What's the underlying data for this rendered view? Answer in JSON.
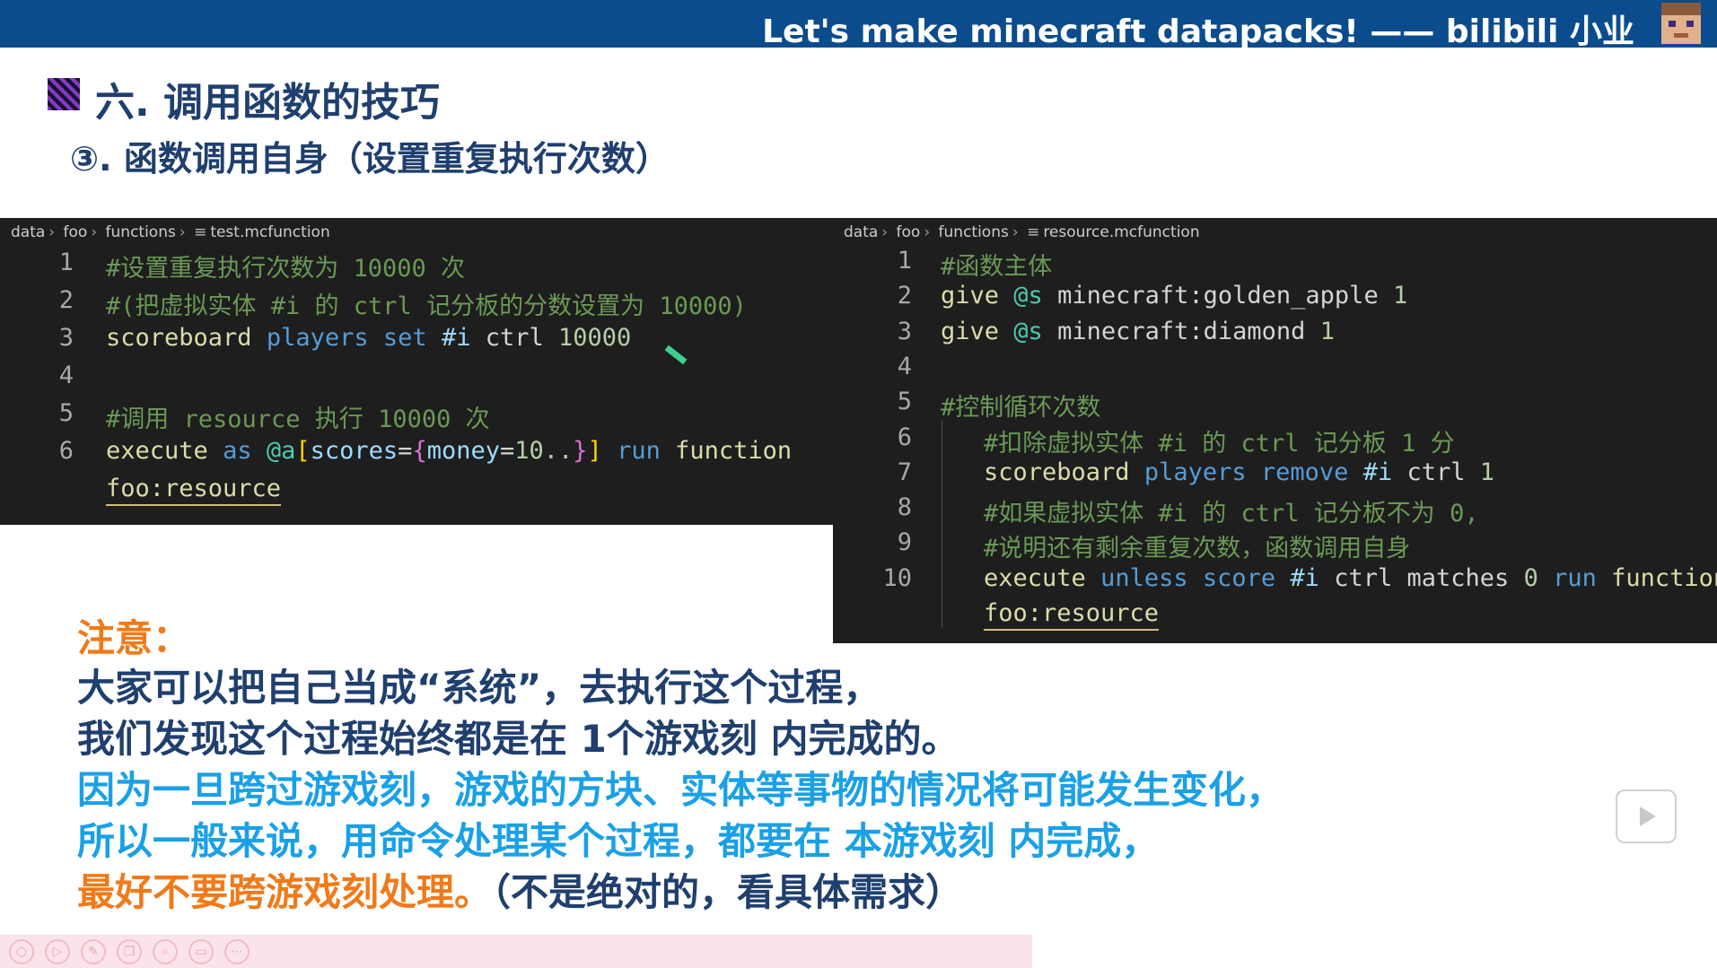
{
  "banner": {
    "title": "Let's make minecraft datapacks! —— bilibili 小业"
  },
  "heading": "六. 调用函数的技巧",
  "subheading": "③. 函数调用自身（设置重复执行次数）",
  "editor_left": {
    "breadcrumb": [
      "data",
      "foo",
      "functions",
      "test.mcfunction"
    ],
    "lines": [
      {
        "n": "1",
        "parts": [
          [
            "#设置重复执行次数为 10000 次",
            "c-comment"
          ]
        ]
      },
      {
        "n": "2",
        "parts": [
          [
            "#(把虚拟实体 #i 的 ctrl 记分板的分数设置为 10000)",
            "c-comment"
          ]
        ]
      },
      {
        "n": "3",
        "parts": [
          [
            "scoreboard",
            "c-kw"
          ],
          [
            " ",
            "c-white"
          ],
          [
            "players",
            "c-blue"
          ],
          [
            " ",
            "c-white"
          ],
          [
            "set",
            "c-blue"
          ],
          [
            " ",
            "c-white"
          ],
          [
            "#i",
            "c-lblue"
          ],
          [
            " ",
            "c-white"
          ],
          [
            "ctrl",
            "c-white"
          ],
          [
            " ",
            "c-white"
          ],
          [
            "10000",
            "c-num"
          ]
        ]
      },
      {
        "n": "4",
        "parts": []
      },
      {
        "n": "5",
        "parts": [
          [
            "#调用 resource 执行 10000 次",
            "c-comment"
          ]
        ]
      },
      {
        "n": "6",
        "parts": [
          [
            "execute",
            "c-kw"
          ],
          [
            " ",
            "c-white"
          ],
          [
            "as",
            "c-blue"
          ],
          [
            " ",
            "c-white"
          ],
          [
            "@a",
            "c-teal"
          ],
          [
            "[",
            "c-gold"
          ],
          [
            "scores",
            "c-lblue"
          ],
          [
            "=",
            "c-white"
          ],
          [
            "{",
            "c-purp"
          ],
          [
            "money",
            "c-lblue"
          ],
          [
            "=",
            "c-white"
          ],
          [
            "10..",
            "c-num"
          ],
          [
            "}",
            "c-purp"
          ],
          [
            "]",
            "c-gold"
          ],
          [
            " ",
            "c-white"
          ],
          [
            "run",
            "c-blue"
          ],
          [
            " ",
            "c-white"
          ],
          [
            "function",
            "c-kw"
          ]
        ]
      },
      {
        "n": "",
        "parts": [
          [
            "foo:resource",
            "c-kw wrap-under"
          ]
        ]
      }
    ]
  },
  "editor_right": {
    "breadcrumb": [
      "data",
      "foo",
      "functions",
      "resource.mcfunction"
    ],
    "lines": [
      {
        "n": "1",
        "indent": false,
        "parts": [
          [
            "#函数主体",
            "c-comment"
          ]
        ]
      },
      {
        "n": "2",
        "indent": false,
        "parts": [
          [
            "give",
            "c-kw"
          ],
          [
            " ",
            "c-white"
          ],
          [
            "@s",
            "c-teal"
          ],
          [
            " ",
            "c-white"
          ],
          [
            "minecraft:golden_apple",
            "c-white"
          ],
          [
            " ",
            "c-white"
          ],
          [
            "1",
            "c-num"
          ]
        ]
      },
      {
        "n": "3",
        "indent": false,
        "parts": [
          [
            "give",
            "c-kw"
          ],
          [
            " ",
            "c-white"
          ],
          [
            "@s",
            "c-teal"
          ],
          [
            " ",
            "c-white"
          ],
          [
            "minecraft:diamond",
            "c-white"
          ],
          [
            " ",
            "c-white"
          ],
          [
            "1",
            "c-num"
          ]
        ]
      },
      {
        "n": "4",
        "indent": false,
        "parts": []
      },
      {
        "n": "5",
        "indent": false,
        "parts": [
          [
            "#控制循环次数",
            "c-comment"
          ]
        ]
      },
      {
        "n": "6",
        "indent": true,
        "parts": [
          [
            "#扣除虚拟实体 #i 的 ctrl 记分板 1 分",
            "c-comment"
          ]
        ]
      },
      {
        "n": "7",
        "indent": true,
        "parts": [
          [
            "scoreboard",
            "c-kw"
          ],
          [
            " ",
            "c-white"
          ],
          [
            "players",
            "c-blue"
          ],
          [
            " ",
            "c-white"
          ],
          [
            "remove",
            "c-blue"
          ],
          [
            " ",
            "c-white"
          ],
          [
            "#i",
            "c-lblue"
          ],
          [
            " ",
            "c-white"
          ],
          [
            "ctrl",
            "c-white"
          ],
          [
            " ",
            "c-white"
          ],
          [
            "1",
            "c-num"
          ]
        ]
      },
      {
        "n": "8",
        "indent": true,
        "parts": [
          [
            "#如果虚拟实体 #i 的 ctrl 记分板不为 0,",
            "c-comment"
          ]
        ]
      },
      {
        "n": "9",
        "indent": true,
        "parts": [
          [
            "#说明还有剩余重复次数，函数调用自身",
            "c-comment"
          ]
        ]
      },
      {
        "n": "10",
        "indent": true,
        "parts": [
          [
            "execute",
            "c-kw"
          ],
          [
            " ",
            "c-white"
          ],
          [
            "unless",
            "c-blue"
          ],
          [
            " ",
            "c-white"
          ],
          [
            "score",
            "c-blue"
          ],
          [
            " ",
            "c-white"
          ],
          [
            "#i",
            "c-lblue"
          ],
          [
            " ",
            "c-white"
          ],
          [
            "ctrl",
            "c-white"
          ],
          [
            " ",
            "c-white"
          ],
          [
            "matches",
            "c-white"
          ],
          [
            " ",
            "c-white"
          ],
          [
            "0",
            "c-num"
          ],
          [
            " ",
            "c-white"
          ],
          [
            "run",
            "c-blue"
          ],
          [
            " ",
            "c-white"
          ],
          [
            "function",
            "c-kw"
          ]
        ]
      },
      {
        "n": "",
        "indent": true,
        "parts": [
          [
            "foo:resource",
            "c-kw wrap-under"
          ]
        ]
      }
    ]
  },
  "note": {
    "title": "注意：",
    "l1": "大家可以把自己当成“系统”，去执行这个过程，",
    "l2": "我们发现这个过程始终都是在 1个游戏刻 内完成的。",
    "l3": "因为一旦跨过游戏刻，游戏的方块、实体等事物的情况将可能发生变化，",
    "l4": "所以一般来说，用命令处理某个过程，都要在 本游戏刻 内完成，",
    "l5_orange": "最好不要跨游戏刻处理。",
    "l5_dark": "（不是绝对的，看具体需求）"
  },
  "toolbar": {
    "icons": [
      "circle-icon",
      "play-icon",
      "pen-icon",
      "copy-icon",
      "zoom-icon",
      "box-icon",
      "more-icon"
    ]
  },
  "colors": {
    "banner": "#0b4d8c",
    "heading": "#1f3f6e",
    "orange": "#f07a1a",
    "blue": "#1aa0e6"
  }
}
